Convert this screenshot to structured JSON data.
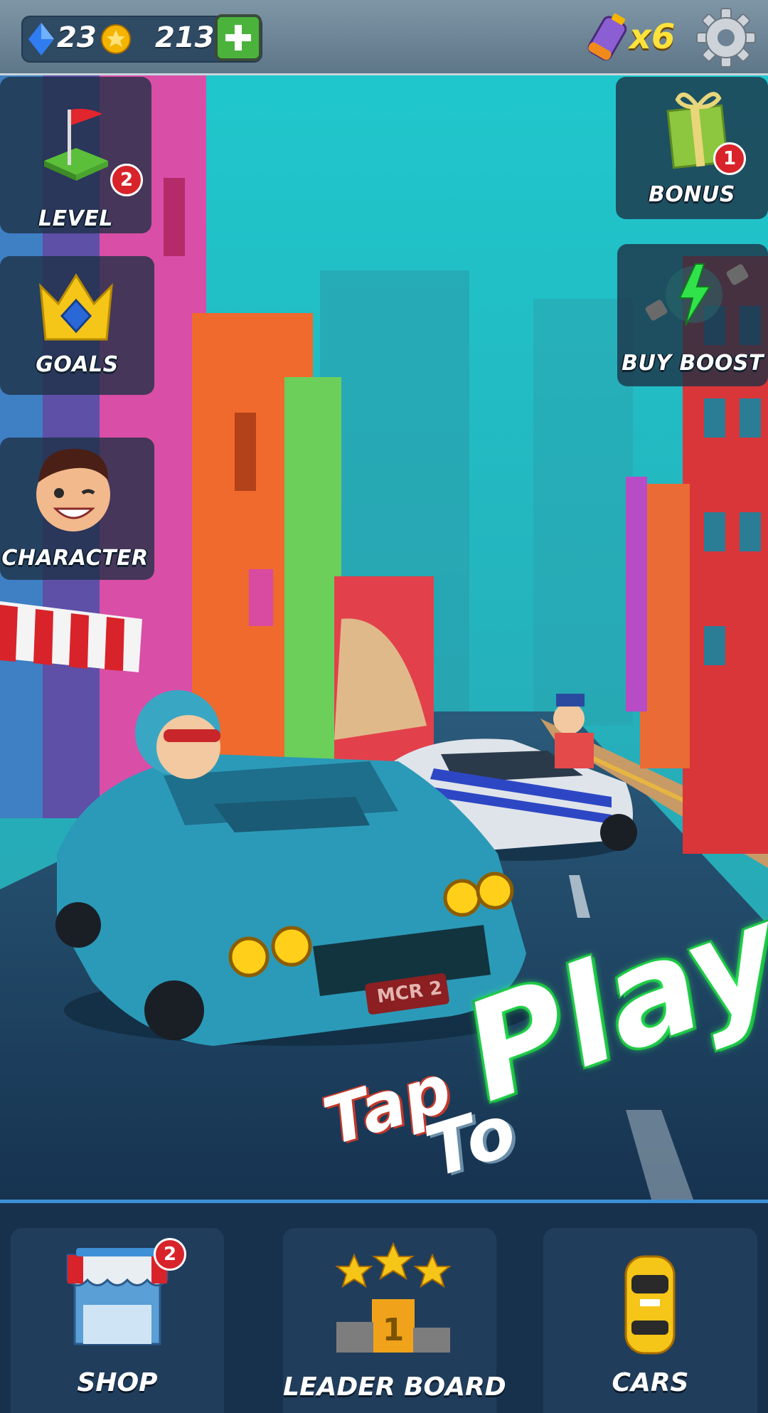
{
  "top_bar": {
    "gems": "23",
    "gem_icon": "blue-gem-icon",
    "coins": "213",
    "coin_icon": "gold-coin-icon",
    "add_icon": "plus-icon",
    "boost_count": "x6",
    "boost_icon": "battery-icon",
    "settings_icon": "gear-icon"
  },
  "left_menu": [
    {
      "label": "LEVEL",
      "icon": "golf-flag-icon",
      "badge": "2"
    },
    {
      "label": "GOALS",
      "icon": "crown-icon"
    },
    {
      "label": "CHARACTER",
      "icon": "character-face-icon"
    }
  ],
  "right_menu": [
    {
      "label": "BONUS",
      "icon": "gift-icon",
      "badge": "1"
    },
    {
      "label": "BUY BOOST",
      "icon": "boost-icon"
    }
  ],
  "play_prompt": {
    "tap": "Tap",
    "to": "To",
    "play": "Play"
  },
  "license_plate": "MCR 2",
  "bottom_nav": [
    {
      "label": "SHOP",
      "icon": "shop-stall-icon",
      "badge": "2"
    },
    {
      "label": "LEADER BOARD",
      "icon": "podium-stars-icon",
      "rank": "1"
    },
    {
      "label": "CARS",
      "icon": "taxi-car-icon"
    }
  ],
  "colors": {
    "sky": "#25bcc4",
    "road": "#1d3c5a",
    "accent_green": "#4bb33c",
    "badge_red": "#d8232a",
    "play_glow": "#2bff5a"
  }
}
